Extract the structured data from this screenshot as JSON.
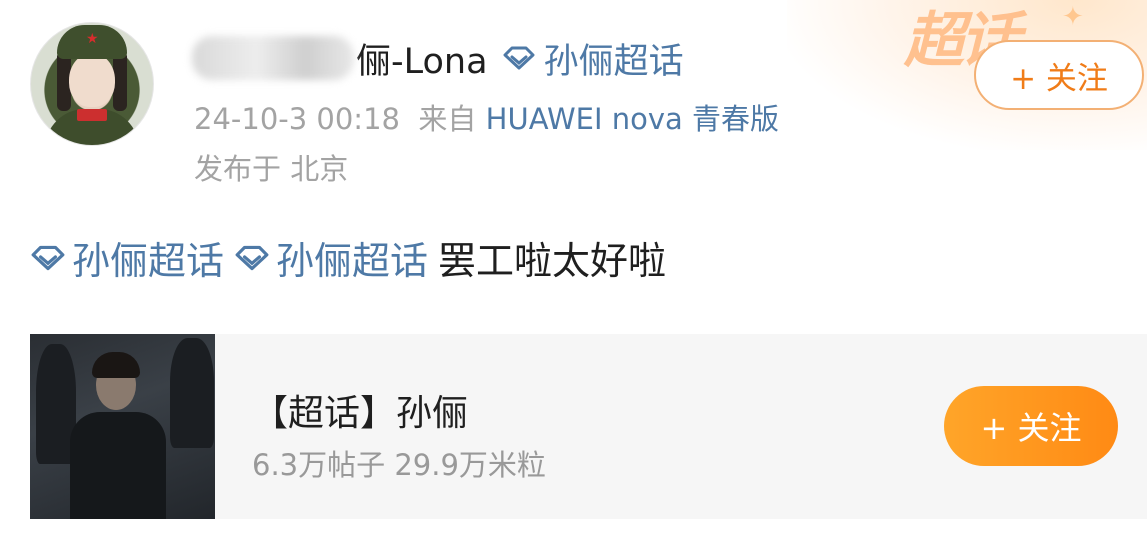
{
  "post": {
    "author": {
      "name_suffix": "俪-Lona",
      "supertopic_label": "孙俪超话"
    },
    "meta": {
      "timestamp": "24-10-3 00:18",
      "source_prefix": "来自",
      "device": "HUAWEI nova 青春版",
      "location": "发布于 北京"
    },
    "follow_label": "+ 关注",
    "badge_text": "超话",
    "content": {
      "topic_1": "孙俪超话",
      "topic_2": "孙俪超话",
      "text": "罢工啦太好啦"
    }
  },
  "card": {
    "title": "【超话】孙俪",
    "stats": "6.3万帖子 29.9万米粒",
    "follow_label": "+ 关注"
  },
  "colors": {
    "link_blue": "#4e79a6",
    "accent_orange": "#ff8a14",
    "meta_gray": "#a3a3a3"
  },
  "icons": [
    "supertopic-gem-icon",
    "sparkle-icon"
  ]
}
